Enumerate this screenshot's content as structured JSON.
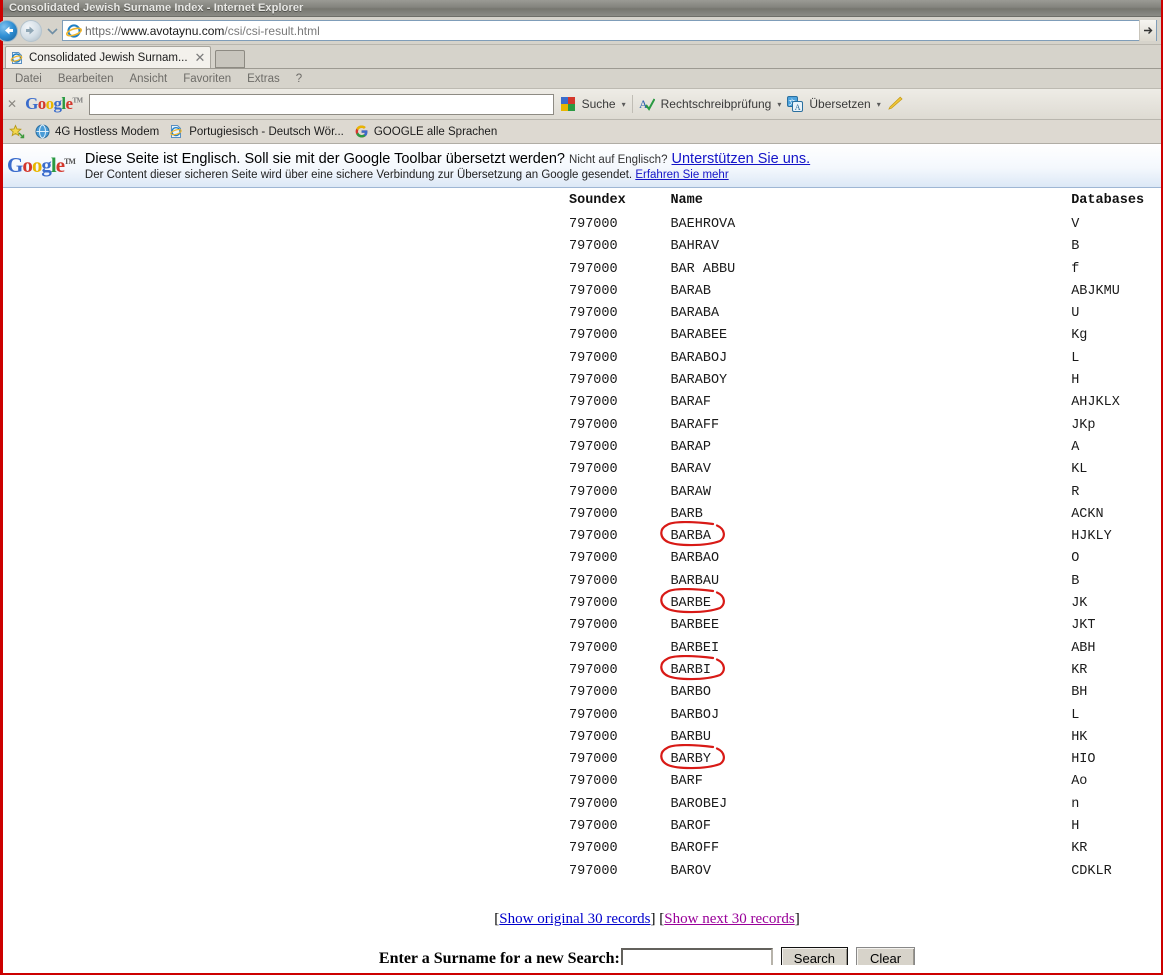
{
  "window": {
    "title": "Consolidated Jewish Surname Index - Internet Explorer"
  },
  "navbar": {
    "back_icon": "back-arrow-icon",
    "forward_icon": "forward-arrow-icon",
    "history_icon": "chevron-down-icon",
    "favicon": "internet-explorer-icon",
    "url_scheme": "https",
    "url_separator": "://",
    "url_host": "www.avotaynu.com",
    "url_path": "/csi/csi-result.html",
    "go_icon": "go-arrow-icon"
  },
  "tabs": [
    {
      "label": "Consolidated Jewish Surnam...",
      "close_label": "✕",
      "favicon": "page-icon"
    }
  ],
  "newtab_label": "",
  "menubar": {
    "items": [
      "Datei",
      "Bearbeiten",
      "Ansicht",
      "Favoriten",
      "Extras",
      "?"
    ]
  },
  "google_toolbar": {
    "close_label": "✕",
    "logo": {
      "g1": "G",
      "o1": "o",
      "o2": "o",
      "g2": "g",
      "l": "l",
      "e": "e",
      "tm": "TM"
    },
    "search_value": "",
    "search_placeholder": "",
    "items": [
      {
        "label": "Suche",
        "icon": "google-search-icon",
        "caret": "▾"
      },
      {
        "label": "Rechtschreibprüfung",
        "icon": "spellcheck-icon",
        "caret": "▾"
      },
      {
        "label": "Übersetzen",
        "icon": "translate-icon",
        "caret": "▾"
      },
      {
        "label": "",
        "icon": "highlighter-pencil-icon",
        "caret": ""
      }
    ]
  },
  "bookmarks": {
    "items": [
      {
        "label": "4G Hostless Modem",
        "icon": "globe-icon"
      },
      {
        "label": "Portugiesisch - Deutsch Wör...",
        "icon": "page-icon"
      },
      {
        "label": "GOOGLE alle Sprachen",
        "icon": "google-g-icon"
      }
    ]
  },
  "notification": {
    "logo": {
      "g1": "G",
      "o1": "o",
      "o2": "o",
      "g2": "g",
      "l": "l",
      "e": "e",
      "tm": "TM"
    },
    "line1_main": "Diese Seite ist Englisch. Soll sie mit der Google Toolbar übersetzt werden?",
    "line1_small": "Nicht auf Englisch?",
    "line1_link": "Unterstützen Sie uns.",
    "line2_text": "Der Content dieser sicheren Seite wird über eine sichere Verbindung zur Übersetzung an Google gesendet.",
    "line2_link": "Erfahren Sie mehr"
  },
  "results_table": {
    "columns": [
      "Soundex",
      "Name",
      "Databases"
    ],
    "rows": [
      {
        "soundex": "797000",
        "name": "BAEHROVA",
        "databases": "V",
        "circled": false
      },
      {
        "soundex": "797000",
        "name": "BAHRAV",
        "databases": "B",
        "circled": false
      },
      {
        "soundex": "797000",
        "name": "BAR ABBU",
        "databases": "f",
        "circled": false
      },
      {
        "soundex": "797000",
        "name": "BARAB",
        "databases": "ABJKMU",
        "circled": false
      },
      {
        "soundex": "797000",
        "name": "BARABA",
        "databases": "U",
        "circled": false
      },
      {
        "soundex": "797000",
        "name": "BARABEE",
        "databases": "Kg",
        "circled": false
      },
      {
        "soundex": "797000",
        "name": "BARABOJ",
        "databases": "L",
        "circled": false
      },
      {
        "soundex": "797000",
        "name": "BARABOY",
        "databases": "H",
        "circled": false
      },
      {
        "soundex": "797000",
        "name": "BARAF",
        "databases": "AHJKLX",
        "circled": false
      },
      {
        "soundex": "797000",
        "name": "BARAFF",
        "databases": "JKp",
        "circled": false
      },
      {
        "soundex": "797000",
        "name": "BARAP",
        "databases": "A",
        "circled": false
      },
      {
        "soundex": "797000",
        "name": "BARAV",
        "databases": "KL",
        "circled": false
      },
      {
        "soundex": "797000",
        "name": "BARAW",
        "databases": "R",
        "circled": false
      },
      {
        "soundex": "797000",
        "name": "BARB",
        "databases": "ACKN",
        "circled": false
      },
      {
        "soundex": "797000",
        "name": "BARBA",
        "databases": "HJKLY",
        "circled": true
      },
      {
        "soundex": "797000",
        "name": "BARBAO",
        "databases": "O",
        "circled": false
      },
      {
        "soundex": "797000",
        "name": "BARBAU",
        "databases": "B",
        "circled": false
      },
      {
        "soundex": "797000",
        "name": "BARBE",
        "databases": "JK",
        "circled": true
      },
      {
        "soundex": "797000",
        "name": "BARBEE",
        "databases": "JKT",
        "circled": false
      },
      {
        "soundex": "797000",
        "name": "BARBEI",
        "databases": "ABH",
        "circled": false
      },
      {
        "soundex": "797000",
        "name": "BARBI",
        "databases": "KR",
        "circled": true
      },
      {
        "soundex": "797000",
        "name": "BARBO",
        "databases": "BH",
        "circled": false
      },
      {
        "soundex": "797000",
        "name": "BARBOJ",
        "databases": "L",
        "circled": false
      },
      {
        "soundex": "797000",
        "name": "BARBU",
        "databases": "HK",
        "circled": false
      },
      {
        "soundex": "797000",
        "name": "BARBY",
        "databases": "HIO",
        "circled": true
      },
      {
        "soundex": "797000",
        "name": "BARF",
        "databases": "Ao",
        "circled": false
      },
      {
        "soundex": "797000",
        "name": "BAROBEJ",
        "databases": "n",
        "circled": false
      },
      {
        "soundex": "797000",
        "name": "BAROF",
        "databases": "H",
        "circled": false
      },
      {
        "soundex": "797000",
        "name": "BAROFF",
        "databases": "KR",
        "circled": false
      },
      {
        "soundex": "797000",
        "name": "BAROV",
        "databases": "CDKLR",
        "circled": false
      }
    ]
  },
  "footer": {
    "open_bracket": "[",
    "close_bracket": "]",
    "link_original": "Show original 30 records",
    "link_next": "Show next 30 records",
    "search_label": "Enter a Surname for a new Search:",
    "search_value": "",
    "search_placeholder": "",
    "search_button": "Search",
    "clear_button": "Clear"
  },
  "colors": {
    "annotation_red": "#d81a16",
    "link_blue": "#0000cc",
    "link_visited": "#990099",
    "border_red": "#cc0000"
  }
}
